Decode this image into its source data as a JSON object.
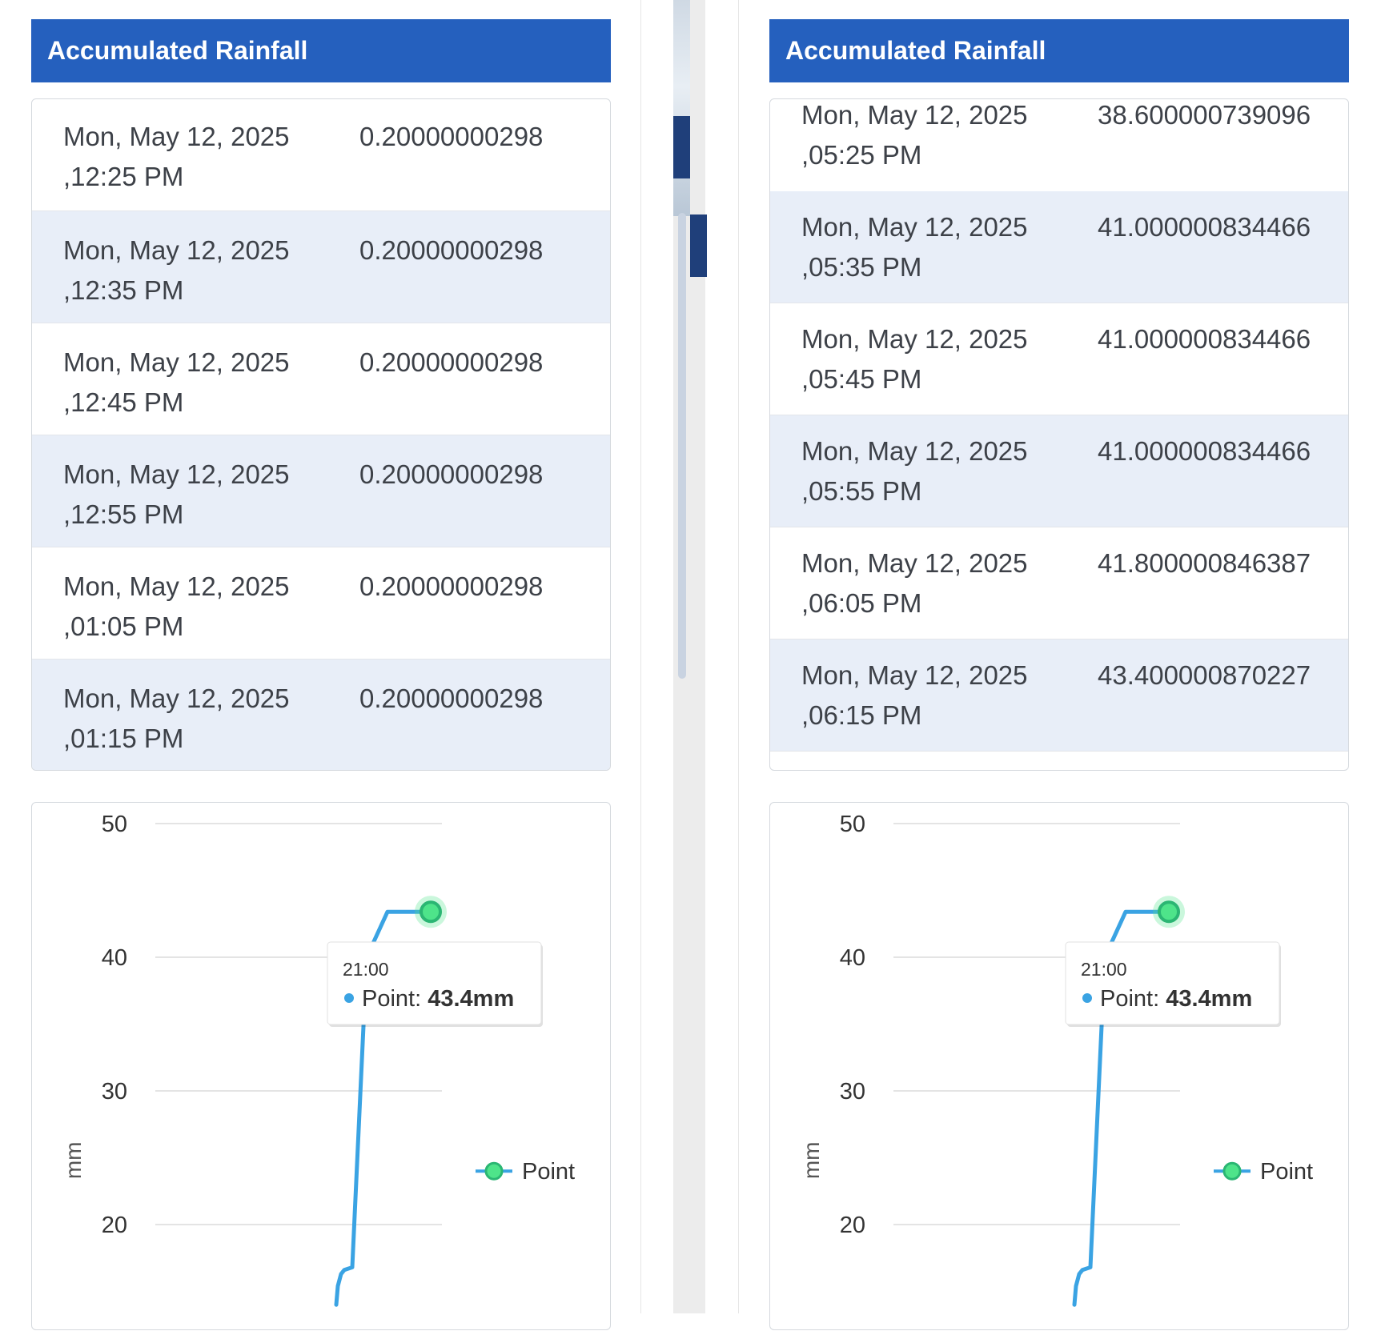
{
  "panels": [
    {
      "header": "Accumulated Rainfall",
      "rows": [
        {
          "date": "Mon, May 12, 2025",
          "time": ",12:25 PM",
          "value": "0.20000000298"
        },
        {
          "date": "Mon, May 12, 2025",
          "time": ",12:35 PM",
          "value": "0.20000000298"
        },
        {
          "date": "Mon, May 12, 2025",
          "time": ",12:45 PM",
          "value": "0.20000000298"
        },
        {
          "date": "Mon, May 12, 2025",
          "time": ",12:55 PM",
          "value": "0.20000000298"
        },
        {
          "date": "Mon, May 12, 2025",
          "time": ",01:05 PM",
          "value": "0.20000000298"
        },
        {
          "date": "Mon, May 12, 2025",
          "time": ",01:15 PM",
          "value": "0.20000000298"
        }
      ]
    },
    {
      "header": "Accumulated Rainfall",
      "rows": [
        {
          "date": "Mon, May 12, 2025",
          "time": ",05:25 PM",
          "value": "38.600000739096"
        },
        {
          "date": "Mon, May 12, 2025",
          "time": ",05:35 PM",
          "value": "41.000000834466"
        },
        {
          "date": "Mon, May 12, 2025",
          "time": ",05:45 PM",
          "value": "41.000000834466"
        },
        {
          "date": "Mon, May 12, 2025",
          "time": ",05:55 PM",
          "value": "41.000000834466"
        },
        {
          "date": "Mon, May 12, 2025",
          "time": ",06:05 PM",
          "value": "41.800000846387"
        },
        {
          "date": "Mon, May 12, 2025",
          "time": ",06:15 PM",
          "value": "43.400000870227"
        }
      ]
    }
  ],
  "chart_data": [
    {
      "type": "line",
      "ylabel": "mm",
      "yticks": [
        20,
        30,
        40,
        50
      ],
      "ylim": [
        14,
        50
      ],
      "legend_position": "right",
      "series": [
        {
          "name": "Point",
          "color": "#3aa3e3",
          "marker_color": "#4ee48a",
          "values": [
            14,
            15.4,
            16.3,
            16.6,
            16.8,
            40,
            43.4,
            43.4,
            43.4
          ]
        }
      ],
      "tooltip": {
        "time": "21:00",
        "label": "Point:",
        "value": "43.4mm"
      }
    },
    {
      "type": "line",
      "ylabel": "mm",
      "yticks": [
        20,
        30,
        40,
        50
      ],
      "ylim": [
        14,
        50
      ],
      "legend_position": "right",
      "series": [
        {
          "name": "Point",
          "color": "#3aa3e3",
          "marker_color": "#4ee48a",
          "values": [
            14,
            15.4,
            16.3,
            16.6,
            16.8,
            40,
            43.4,
            43.4,
            43.4
          ]
        }
      ],
      "tooltip": {
        "time": "21:00",
        "label": "Point:",
        "value": "43.4mm"
      }
    }
  ]
}
